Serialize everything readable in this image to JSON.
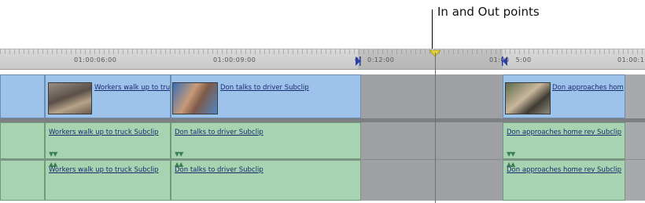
{
  "callout": {
    "text": "In and Out points"
  },
  "ruler": {
    "timecodes": [
      "01:00:06:00",
      "01:00:09:00",
      "01:00:12:00",
      "01:00:15:00",
      "01:00:1"
    ]
  },
  "video_clips": [
    {
      "label": "Workers walk up to tru"
    },
    {
      "label": "Don talks to driver Subclip"
    },
    {
      "label": "Don approaches hom"
    }
  ],
  "audio_track_1": [
    {
      "label": "Workers walk up to truck Subclip"
    },
    {
      "label": "Don talks to driver Subclip"
    },
    {
      "label": "Don approaches home rev Subclip"
    }
  ],
  "audio_track_2": [
    {
      "label": "Workers walk up to truck Subclip"
    },
    {
      "label": "Don talks to driver Subclip"
    },
    {
      "label": "Don approaches home rev Subclip"
    }
  ],
  "colors": {
    "video_clip": "#9dc3ea",
    "audio_clip": "#a7d3b0",
    "in_out_marker": "#2b3fa8",
    "playhead_marker": "#e8d23a"
  },
  "icons": {
    "in_point": "in-point-icon",
    "out_point": "out-point-icon",
    "playhead": "playhead-icon",
    "audio_marker": "audio-keyframe-icon"
  }
}
